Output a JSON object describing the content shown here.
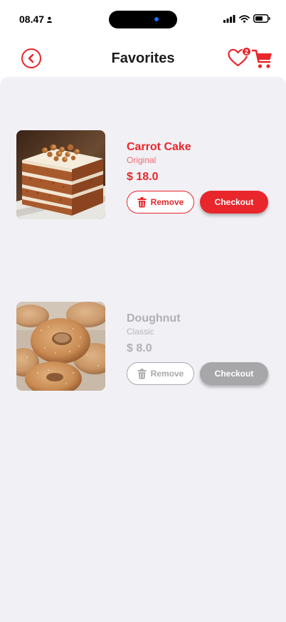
{
  "status_bar": {
    "time": "08.47"
  },
  "header": {
    "title": "Favorites",
    "favorites_count": "2"
  },
  "items": [
    {
      "name": "Carrot Cake",
      "variant": "Original",
      "price": "$ 18.0",
      "remove_label": "Remove",
      "checkout_label": "Checkout",
      "image": "carrot-cake-photo"
    },
    {
      "name": "Doughnut",
      "variant": "Classic",
      "price": "$ 8.0",
      "remove_label": "Remove",
      "checkout_label": "Checkout",
      "image": "doughnut-photo"
    }
  ],
  "colors": {
    "accent": "#e8262b",
    "disabled": "#a9a9ad",
    "background": "#f1f0f5"
  }
}
